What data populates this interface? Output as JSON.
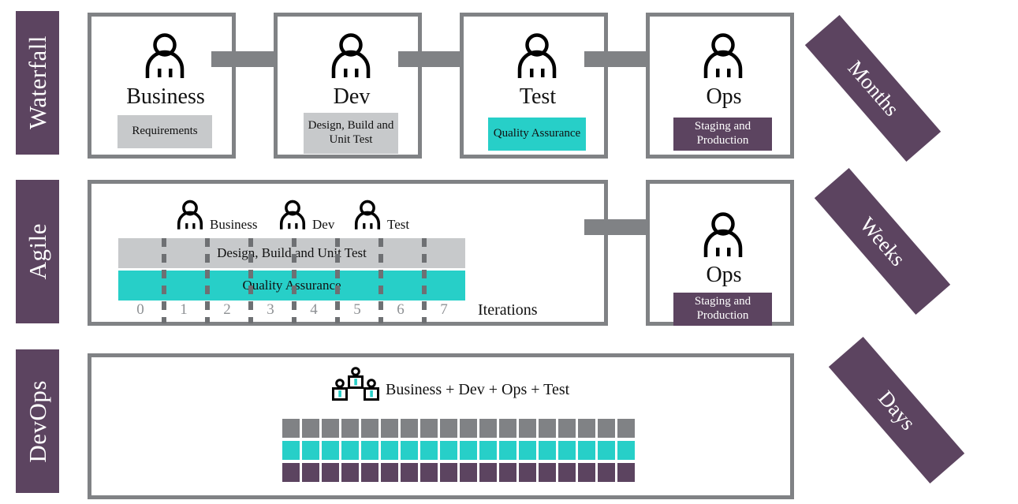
{
  "diagram": {
    "title": "Waterfall vs Agile vs DevOps delivery comparison",
    "colors": {
      "purple": "#5C4460",
      "teal": "#27CFC8",
      "light_gray": "#C7C9CB",
      "gray": "#808285",
      "white": "#FFFFFF",
      "dash_gray": "#6E7073",
      "number_gray": "#8E9194"
    }
  },
  "rows": [
    {
      "id": "waterfall",
      "label": "Waterfall",
      "duration": "Months"
    },
    {
      "id": "agile",
      "label": "Agile",
      "duration": "Weeks"
    },
    {
      "id": "devops",
      "label": "DevOps",
      "duration": "Days"
    }
  ],
  "waterfall": {
    "stages": [
      {
        "icon": "person-icon",
        "role": "Business",
        "chip": "Requirements",
        "chip_style": "gray"
      },
      {
        "icon": "person-icon",
        "role": "Dev",
        "chip": "Design, Build and Unit Test",
        "chip_style": "gray"
      },
      {
        "icon": "person-icon",
        "role": "Test",
        "chip": "Quality Assurance",
        "chip_style": "teal"
      },
      {
        "icon": "person-icon",
        "role": "Ops",
        "chip": "Staging and Production",
        "chip_style": "purple"
      }
    ],
    "arrow_count": 3
  },
  "agile": {
    "roles": [
      {
        "icon": "person-icon",
        "label": "Business"
      },
      {
        "icon": "person-icon",
        "label": "Dev"
      },
      {
        "icon": "person-icon",
        "label": "Test"
      }
    ],
    "bars": [
      {
        "label": "Design, Build and Unit Test",
        "style": "gray"
      },
      {
        "label": "Quality Assurance",
        "style": "teal"
      }
    ],
    "iterations": [
      "0",
      "1",
      "2",
      "3",
      "4",
      "5",
      "6",
      "7"
    ],
    "iterations_label": "Iterations",
    "ops_stage": {
      "icon": "person-icon",
      "role": "Ops",
      "chip": "Staging and Production",
      "chip_style": "purple"
    },
    "arrow_count": 1
  },
  "devops": {
    "team_icon": "team-group-icon",
    "team_label": "Business + Dev + Ops + Test",
    "square_rows": [
      {
        "style": "gray",
        "count": 18
      },
      {
        "style": "teal",
        "count": 18
      },
      {
        "style": "purple",
        "count": 18
      }
    ]
  }
}
